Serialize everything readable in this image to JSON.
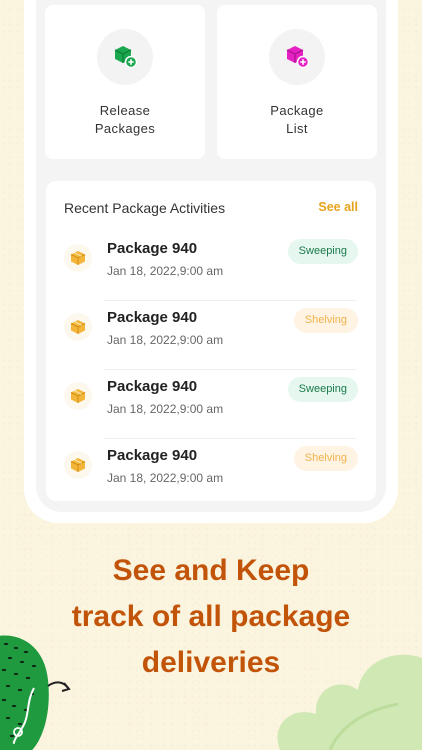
{
  "tiles": [
    {
      "line1": "Release",
      "line2": "Packages",
      "icon": "box-add-icon",
      "color": "#1aa84f"
    },
    {
      "line1": "Package",
      "line2": "List",
      "icon": "box-add-icon",
      "color": "#e521c4"
    }
  ],
  "recent": {
    "title": "Recent Package Activities",
    "see_all": "See all",
    "items": [
      {
        "name": "Package 940",
        "date": "Jan 18, 2022,9:00 am",
        "status": "Sweeping"
      },
      {
        "name": "Package 940",
        "date": "Jan 18, 2022,9:00 am",
        "status": "Shelving"
      },
      {
        "name": "Package 940",
        "date": "Jan 18, 2022,9:00 am",
        "status": "Sweeping"
      },
      {
        "name": "Package 940",
        "date": "Jan 18, 2022,9:00 am",
        "status": "Shelving"
      }
    ]
  },
  "headline": {
    "line1": "See and Keep",
    "line2": "track of all package",
    "line3": "deliveries"
  },
  "colors": {
    "accent": "#c2540a",
    "see_all": "#e6a31a",
    "sweeping_bg": "#e6f7ef",
    "sweeping_text": "#1a7a4c",
    "shelving_bg": "#fff4e4",
    "shelving_text": "#f0b24b",
    "background": "#fbf4df"
  }
}
